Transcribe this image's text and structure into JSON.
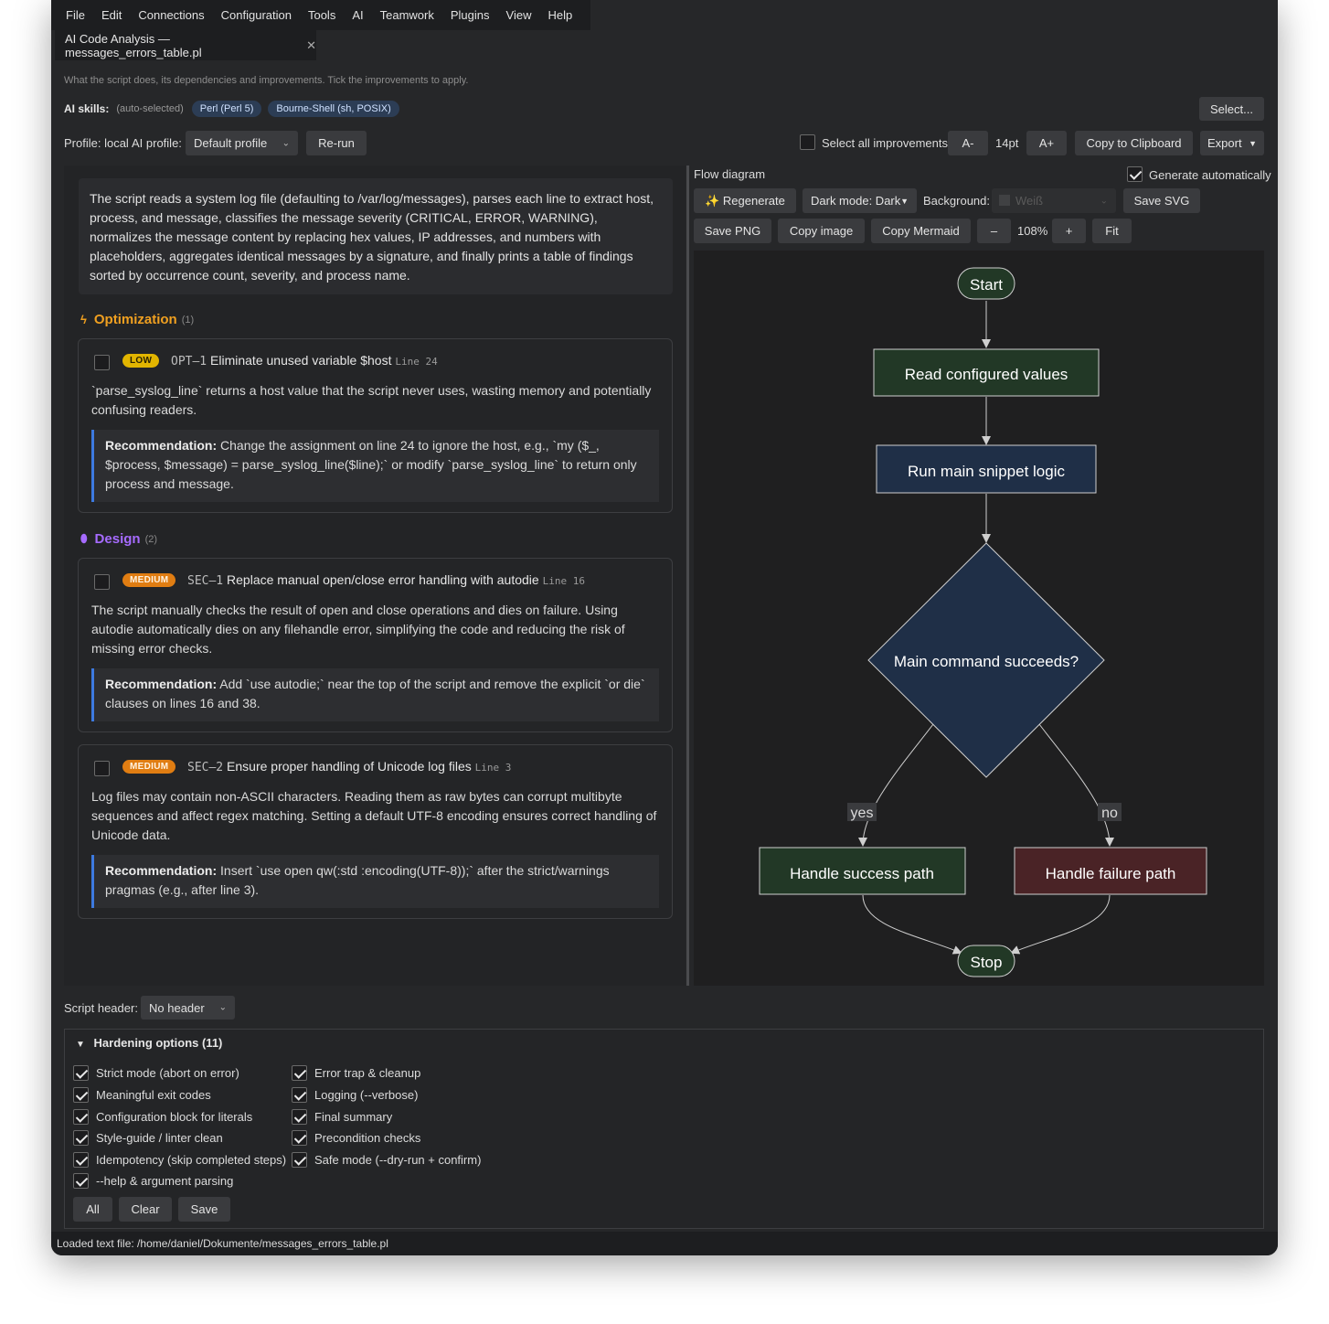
{
  "menu": [
    "File",
    "Edit",
    "Connections",
    "Configuration",
    "Tools",
    "AI",
    "Teamwork",
    "Plugins",
    "View",
    "Help"
  ],
  "tab": {
    "title": "AI Code Analysis — messages_errors_table.pl",
    "close": "✕"
  },
  "subtitle": "What the script does, its dependencies and improvements. Tick the improvements to apply.",
  "skills": {
    "label": "AI skills:",
    "auto": "(auto-selected)",
    "chips": [
      "Perl (Perl 5)",
      "Bourne-Shell (sh, POSIX)"
    ],
    "select_button": "Select..."
  },
  "toolbar": {
    "profile_label": "Profile: local",
    "ai_profile_label": "AI profile:",
    "ai_profile_value": "Default profile",
    "rerun": "Re-run",
    "select_all": "Select all improvements",
    "font_minus": "A-",
    "font_size": "14pt",
    "font_plus": "A+",
    "copy_clipboard": "Copy to Clipboard",
    "export": "Export"
  },
  "summary": "The script reads a system log file (defaulting to /var/log/messages), parses each line to extract host, process, and message, classifies the message severity (CRITICAL, ERROR, WARNING), normalizes the message content by replacing hex values, IP addresses, and numbers with placeholders, aggregates identical messages by a signature, and finally prints a table of findings sorted by occurrence count, severity, and process name.",
  "sections": {
    "optimization": {
      "title": "Optimization",
      "count": "(1)",
      "color": "#f0a020"
    },
    "design": {
      "title": "Design",
      "count": "(2)",
      "color": "#a66bff"
    }
  },
  "findings": [
    {
      "severity": "LOW",
      "id": "OPT–1",
      "title": "Eliminate unused variable $host",
      "line": "Line 24",
      "description": "`parse_syslog_line` returns a host value that the script never uses, wasting memory and potentially confusing readers.",
      "rec_label": "Recommendation:",
      "recommendation": "Change the assignment on line 24 to ignore the host, e.g., `my ($_, $process, $message) = parse_syslog_line($line);` or modify `parse_syslog_line` to return only process and message."
    },
    {
      "severity": "MEDIUM",
      "id": "SEC–1",
      "title": "Replace manual open/close error handling with autodie",
      "line": "Line 16",
      "description": "The script manually checks the result of open and close operations and dies on failure. Using autodie automatically dies on any filehandle error, simplifying the code and reducing the risk of missing error checks.",
      "rec_label": "Recommendation:",
      "recommendation": "Add `use autodie;` near the top of the script and remove the explicit `or die` clauses on lines 16 and 38."
    },
    {
      "severity": "MEDIUM",
      "id": "SEC–2",
      "title": "Ensure proper handling of Unicode log files",
      "line": "Line 3",
      "description": "Log files may contain non-ASCII characters. Reading them as raw bytes can corrupt multibyte sequences and affect regex matching. Setting a default UTF-8 encoding ensures correct handling of Unicode data.",
      "rec_label": "Recommendation:",
      "recommendation": "Insert `use open qw(:std :encoding(UTF-8));` after the strict/warnings pragmas (e.g., after line 3)."
    }
  ],
  "flow": {
    "title": "Flow diagram",
    "generate_auto": "Generate automatically",
    "regenerate": "✨ Regenerate",
    "dark_mode": "Dark mode: Dark",
    "background_label": "Background:",
    "background_value": "Weiß",
    "save_svg": "Save SVG",
    "save_png": "Save PNG",
    "copy_image": "Copy image",
    "copy_mermaid": "Copy Mermaid",
    "zoom_out": "–",
    "zoom": "108%",
    "zoom_in": "+",
    "fit": "Fit",
    "nodes": {
      "start": "Start",
      "read": "Read configured values",
      "run": "Run main snippet logic",
      "decision": "Main command succeeds?",
      "success": "Handle success path",
      "failure": "Handle failure path",
      "stop": "Stop",
      "yes": "yes",
      "no": "no"
    }
  },
  "script_header": {
    "label": "Script header:",
    "value": "No header"
  },
  "hardening": {
    "title": "Hardening options (11)",
    "col1": [
      "Strict mode (abort on error)",
      "Meaningful exit codes",
      "Configuration block for literals",
      "Style-guide / linter clean",
      "Idempotency (skip completed steps)",
      "--help & argument parsing"
    ],
    "col2": [
      "Error trap & cleanup",
      "Logging (--verbose)",
      "Final summary",
      "Precondition checks",
      "Safe mode (--dry-run + confirm)"
    ],
    "all": "All",
    "clear": "Clear",
    "save": "Save"
  },
  "status": "Loaded text file: /home/daniel/Dokumente/messages_errors_table.pl",
  "colors": {
    "accent_blue": "#3d7ae0",
    "low_badge": "#e2b500",
    "medium_badge": "#e07d12",
    "node_green": "#223826",
    "node_blue": "#1f2f47",
    "node_red": "#4a2326"
  }
}
